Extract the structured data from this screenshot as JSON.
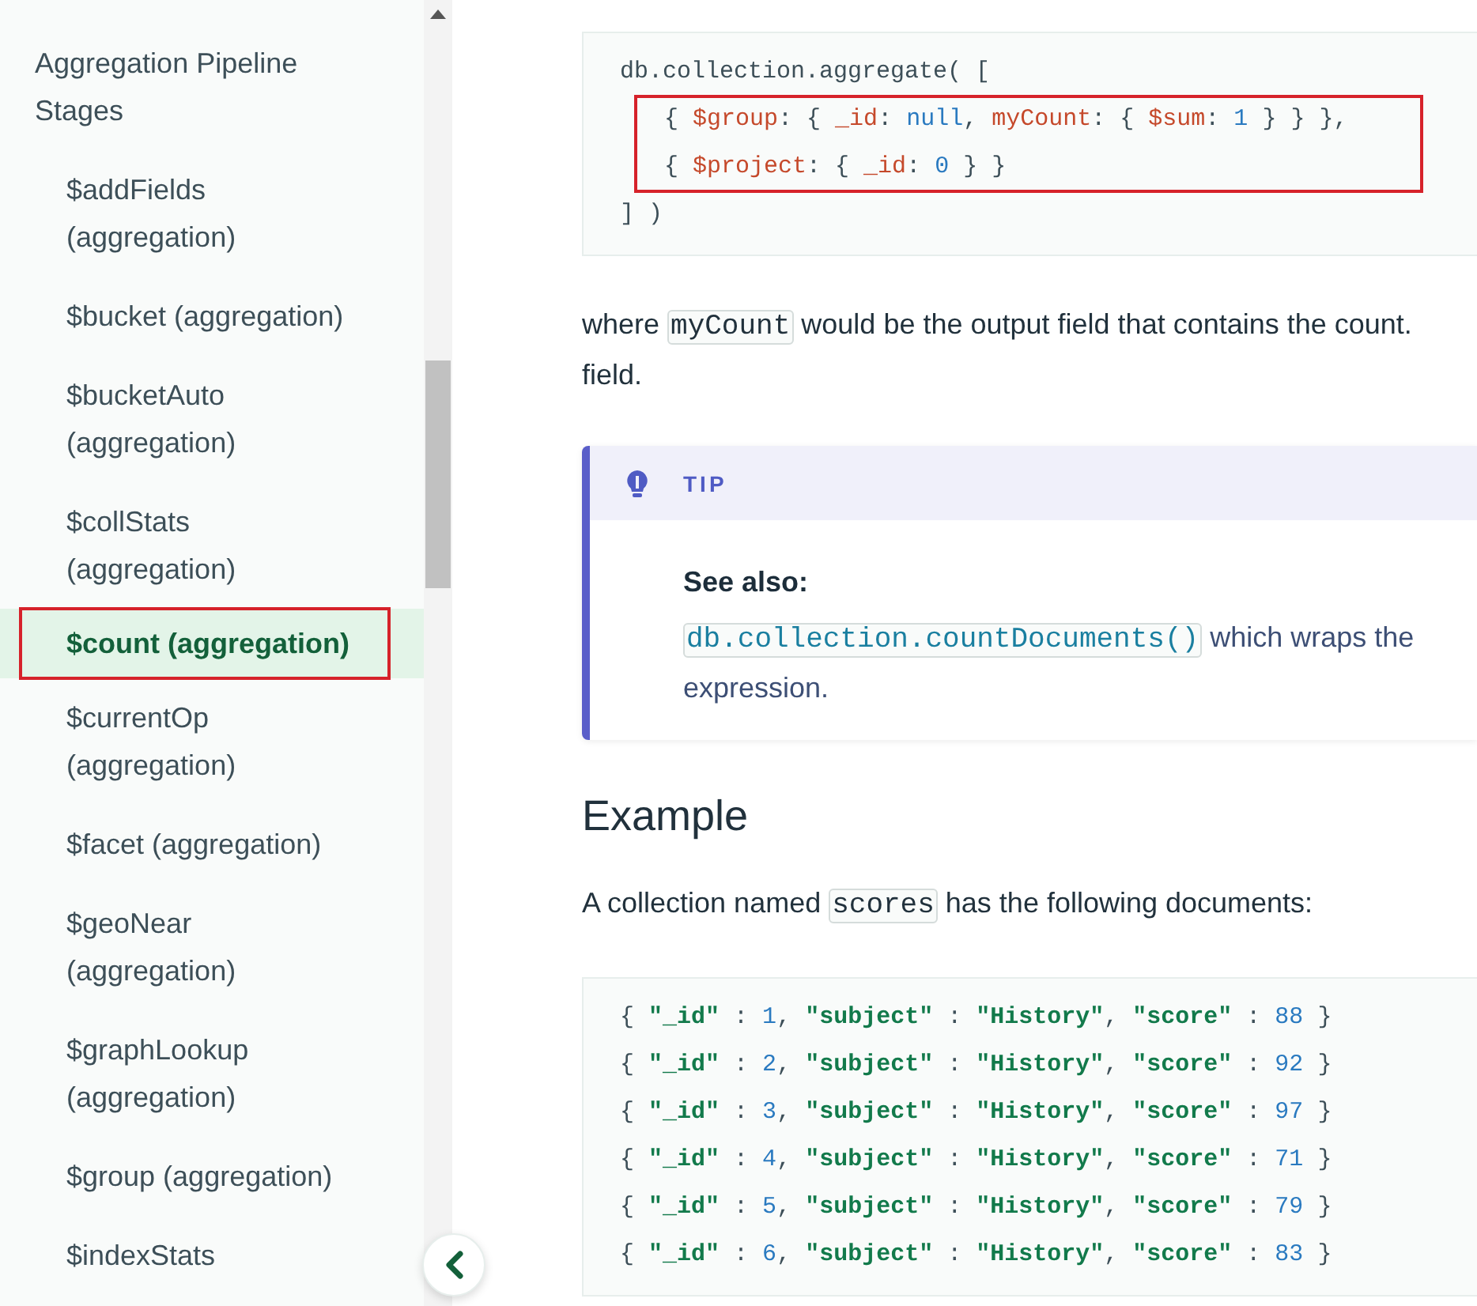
{
  "sidebar": {
    "sections": [
      {
        "label": "Aggregation Pipeline Stages",
        "children": [
          {
            "label": "$addFields (aggregation)",
            "selected": false,
            "highlighted": false
          },
          {
            "label": "$bucket (aggregation)",
            "selected": false,
            "highlighted": false
          },
          {
            "label": "$bucketAuto (aggregation)",
            "selected": false,
            "highlighted": false
          },
          {
            "label": "$collStats (aggregation)",
            "selected": false,
            "highlighted": false
          },
          {
            "label": "$count (aggregation)",
            "selected": true,
            "highlighted": true
          },
          {
            "label": "$currentOp (aggregation)",
            "selected": false,
            "highlighted": false
          },
          {
            "label": "$facet (aggregation)",
            "selected": false,
            "highlighted": false
          },
          {
            "label": "$geoNear (aggregation)",
            "selected": false,
            "highlighted": false
          },
          {
            "label": "$graphLookup (aggregation)",
            "selected": false,
            "highlighted": false
          },
          {
            "label": "$group (aggregation)",
            "selected": false,
            "highlighted": false
          },
          {
            "label": "$indexStats",
            "selected": false,
            "highlighted": false
          }
        ]
      }
    ]
  },
  "content": [
    {
      "kind": "code",
      "lines": [
        {
          "highlighted": false,
          "tokens": [
            {
              "kind": "plain",
              "text": "db.collection.aggregate( ["
            }
          ]
        },
        {
          "highlighted": true,
          "tokens": [
            {
              "kind": "plain",
              "text": "  { "
            },
            {
              "kind": "key",
              "text": "$group"
            },
            {
              "kind": "plain",
              "text": ": { "
            },
            {
              "kind": "key",
              "text": "_id"
            },
            {
              "kind": "plain",
              "text": ": "
            },
            {
              "kind": "number",
              "text": "null"
            },
            {
              "kind": "plain",
              "text": ", "
            },
            {
              "kind": "key",
              "text": "myCount"
            },
            {
              "kind": "plain",
              "text": ": { "
            },
            {
              "kind": "key",
              "text": "$sum"
            },
            {
              "kind": "plain",
              "text": ": "
            },
            {
              "kind": "number",
              "text": "1"
            },
            {
              "kind": "plain",
              "text": " } } },"
            }
          ]
        },
        {
          "highlighted": true,
          "tokens": [
            {
              "kind": "plain",
              "text": "  { "
            },
            {
              "kind": "key",
              "text": "$project"
            },
            {
              "kind": "plain",
              "text": ": { "
            },
            {
              "kind": "key",
              "text": "_id"
            },
            {
              "kind": "plain",
              "text": ": "
            },
            {
              "kind": "number",
              "text": "0"
            },
            {
              "kind": "plain",
              "text": " } }"
            }
          ]
        },
        {
          "highlighted": false,
          "tokens": [
            {
              "kind": "plain",
              "text": "] )"
            }
          ]
        }
      ]
    },
    {
      "kind": "paragraph",
      "lines": [
        [
          {
            "kind": "text",
            "text": "where "
          },
          {
            "kind": "code",
            "text": "myCount"
          },
          {
            "kind": "text",
            "text": " would be the output field that contains the count."
          }
        ],
        [
          {
            "kind": "text",
            "text": "field."
          }
        ]
      ]
    },
    {
      "kind": "tip",
      "label": "TIP",
      "title": "See also:",
      "lines": [
        [
          {
            "kind": "code",
            "text": "db.collection.countDocuments()"
          },
          {
            "kind": "text",
            "text": " which wraps the"
          }
        ],
        [
          {
            "kind": "text",
            "text": "expression."
          }
        ]
      ]
    },
    {
      "kind": "heading",
      "text": "Example"
    },
    {
      "kind": "paragraph",
      "lines": [
        [
          {
            "kind": "text",
            "text": "A collection named "
          },
          {
            "kind": "code",
            "text": "scores"
          },
          {
            "kind": "text",
            "text": " has the following documents:"
          }
        ]
      ]
    },
    {
      "kind": "code",
      "lines": [
        {
          "highlighted": false,
          "tokens": [
            {
              "kind": "plain",
              "text": "{ "
            },
            {
              "kind": "string",
              "text": "\"_id\""
            },
            {
              "kind": "plain",
              "text": " : "
            },
            {
              "kind": "number",
              "text": "1"
            },
            {
              "kind": "plain",
              "text": ", "
            },
            {
              "kind": "string",
              "text": "\"subject\""
            },
            {
              "kind": "plain",
              "text": " : "
            },
            {
              "kind": "string",
              "text": "\"History\""
            },
            {
              "kind": "plain",
              "text": ", "
            },
            {
              "kind": "string",
              "text": "\"score\""
            },
            {
              "kind": "plain",
              "text": " : "
            },
            {
              "kind": "number",
              "text": "88"
            },
            {
              "kind": "plain",
              "text": " }"
            }
          ]
        },
        {
          "highlighted": false,
          "tokens": [
            {
              "kind": "plain",
              "text": "{ "
            },
            {
              "kind": "string",
              "text": "\"_id\""
            },
            {
              "kind": "plain",
              "text": " : "
            },
            {
              "kind": "number",
              "text": "2"
            },
            {
              "kind": "plain",
              "text": ", "
            },
            {
              "kind": "string",
              "text": "\"subject\""
            },
            {
              "kind": "plain",
              "text": " : "
            },
            {
              "kind": "string",
              "text": "\"History\""
            },
            {
              "kind": "plain",
              "text": ", "
            },
            {
              "kind": "string",
              "text": "\"score\""
            },
            {
              "kind": "plain",
              "text": " : "
            },
            {
              "kind": "number",
              "text": "92"
            },
            {
              "kind": "plain",
              "text": " }"
            }
          ]
        },
        {
          "highlighted": false,
          "tokens": [
            {
              "kind": "plain",
              "text": "{ "
            },
            {
              "kind": "string",
              "text": "\"_id\""
            },
            {
              "kind": "plain",
              "text": " : "
            },
            {
              "kind": "number",
              "text": "3"
            },
            {
              "kind": "plain",
              "text": ", "
            },
            {
              "kind": "string",
              "text": "\"subject\""
            },
            {
              "kind": "plain",
              "text": " : "
            },
            {
              "kind": "string",
              "text": "\"History\""
            },
            {
              "kind": "plain",
              "text": ", "
            },
            {
              "kind": "string",
              "text": "\"score\""
            },
            {
              "kind": "plain",
              "text": " : "
            },
            {
              "kind": "number",
              "text": "97"
            },
            {
              "kind": "plain",
              "text": " }"
            }
          ]
        },
        {
          "highlighted": false,
          "tokens": [
            {
              "kind": "plain",
              "text": "{ "
            },
            {
              "kind": "string",
              "text": "\"_id\""
            },
            {
              "kind": "plain",
              "text": " : "
            },
            {
              "kind": "number",
              "text": "4"
            },
            {
              "kind": "plain",
              "text": ", "
            },
            {
              "kind": "string",
              "text": "\"subject\""
            },
            {
              "kind": "plain",
              "text": " : "
            },
            {
              "kind": "string",
              "text": "\"History\""
            },
            {
              "kind": "plain",
              "text": ", "
            },
            {
              "kind": "string",
              "text": "\"score\""
            },
            {
              "kind": "plain",
              "text": " : "
            },
            {
              "kind": "number",
              "text": "71"
            },
            {
              "kind": "plain",
              "text": " }"
            }
          ]
        },
        {
          "highlighted": false,
          "tokens": [
            {
              "kind": "plain",
              "text": "{ "
            },
            {
              "kind": "string",
              "text": "\"_id\""
            },
            {
              "kind": "plain",
              "text": " : "
            },
            {
              "kind": "number",
              "text": "5"
            },
            {
              "kind": "plain",
              "text": ", "
            },
            {
              "kind": "string",
              "text": "\"subject\""
            },
            {
              "kind": "plain",
              "text": " : "
            },
            {
              "kind": "string",
              "text": "\"History\""
            },
            {
              "kind": "plain",
              "text": ", "
            },
            {
              "kind": "string",
              "text": "\"score\""
            },
            {
              "kind": "plain",
              "text": " : "
            },
            {
              "kind": "number",
              "text": "79"
            },
            {
              "kind": "plain",
              "text": " }"
            }
          ]
        },
        {
          "highlighted": false,
          "tokens": [
            {
              "kind": "plain",
              "text": "{ "
            },
            {
              "kind": "string",
              "text": "\"_id\""
            },
            {
              "kind": "plain",
              "text": " : "
            },
            {
              "kind": "number",
              "text": "6"
            },
            {
              "kind": "plain",
              "text": ", "
            },
            {
              "kind": "string",
              "text": "\"subject\""
            },
            {
              "kind": "plain",
              "text": " : "
            },
            {
              "kind": "string",
              "text": "\"History\""
            },
            {
              "kind": "plain",
              "text": ", "
            },
            {
              "kind": "string",
              "text": "\"score\""
            },
            {
              "kind": "plain",
              "text": " : "
            },
            {
              "kind": "number",
              "text": "83"
            },
            {
              "kind": "plain",
              "text": " }"
            }
          ]
        }
      ]
    }
  ]
}
